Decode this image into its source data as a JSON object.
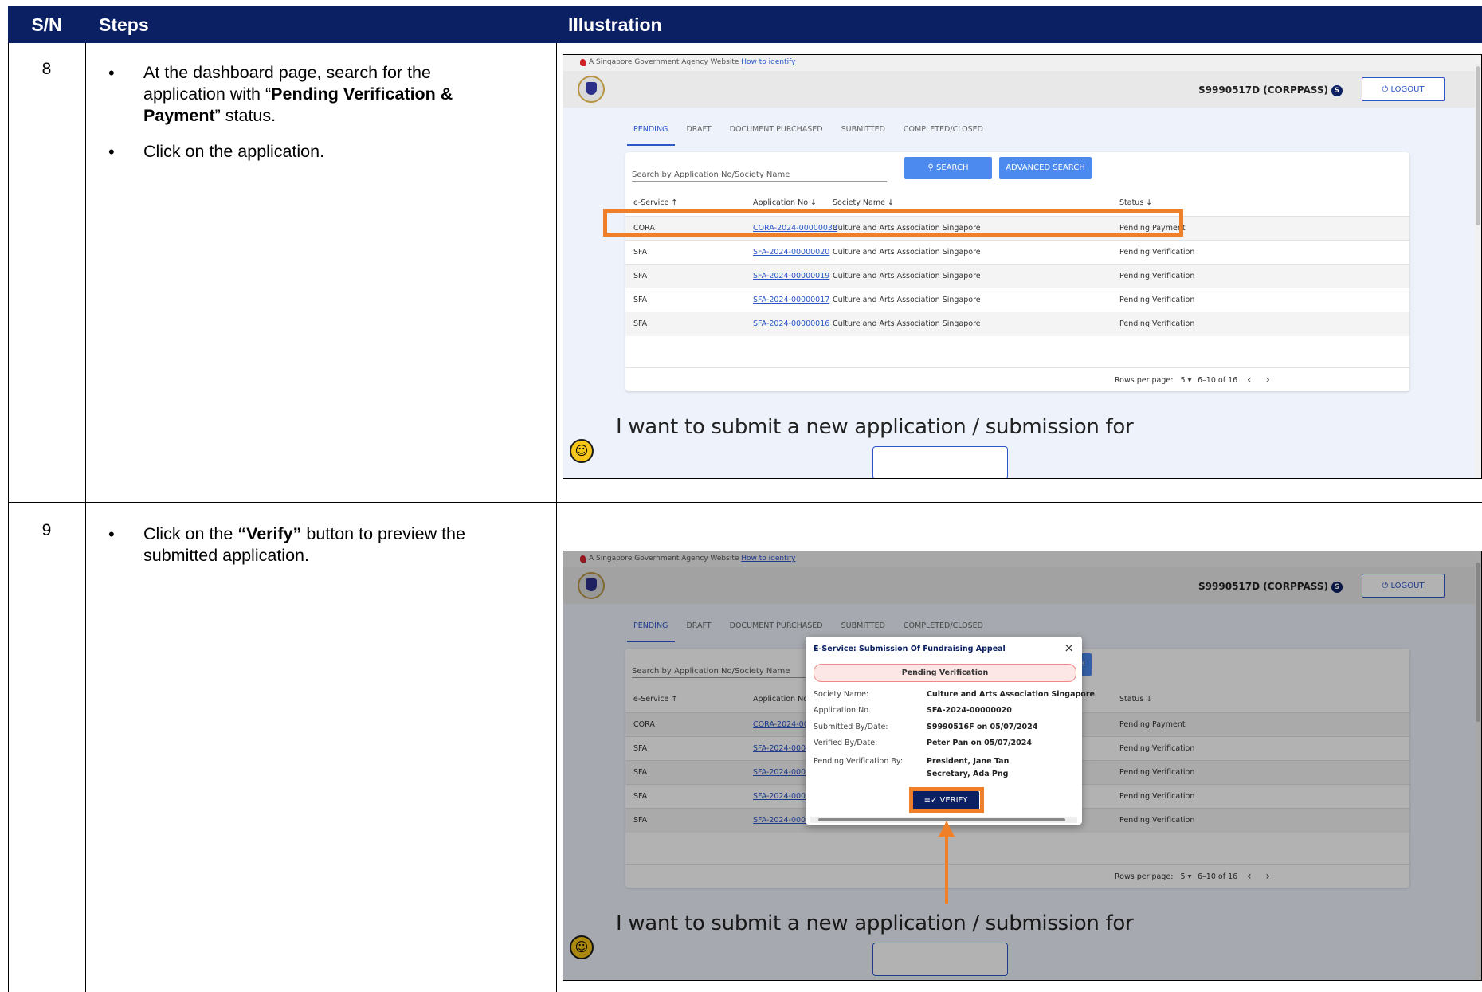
{
  "table": {
    "headers": {
      "sn": "S/N",
      "steps": "Steps",
      "illustration": "Illustration"
    },
    "header_color": "#0b2063",
    "rows": [
      {
        "sn": "8",
        "step1_pre": "At the dashboard page, search for the application with “",
        "step1_bold": "Pending Verification & Payment",
        "step1_post": "” status.",
        "step2": "Click on the application."
      },
      {
        "sn": "9",
        "step1_pre": "Click on the ",
        "step1_bold": "“Verify”",
        "step1_post": " button to preview the submitted application."
      }
    ]
  },
  "app": {
    "gov_banner": "A Singapore Government Agency Website",
    "gov_link": "How to identify",
    "user_id": "S9990517D (CORPPASS)",
    "user_badge": "S",
    "logout": "LOGOUT",
    "tabs": [
      "PENDING",
      "DRAFT",
      "DOCUMENT PURCHASED",
      "SUBMITTED",
      "COMPLETED/CLOSED"
    ],
    "search_placeholder": "Search by Application No/Society Name",
    "search_button": "SEARCH",
    "advanced_search_button": "ADVANCED SEARCH",
    "columns": [
      "e-Service ↑",
      "Application No ↓",
      "Society Name ↓",
      "Status ↓"
    ],
    "rows": [
      {
        "service": "CORA",
        "app_no": "CORA-2024-00000033",
        "society": "Culture and Arts Association Singapore",
        "status": "Pending Payment"
      },
      {
        "service": "SFA",
        "app_no": "SFA-2024-00000020",
        "society": "Culture and Arts Association Singapore",
        "status": "Pending Verification"
      },
      {
        "service": "SFA",
        "app_no": "SFA-2024-00000019",
        "society": "Culture and Arts Association Singapore",
        "status": "Pending Verification"
      },
      {
        "service": "SFA",
        "app_no": "SFA-2024-00000017",
        "society": "Culture and Arts Association Singapore",
        "status": "Pending Verification"
      },
      {
        "service": "SFA",
        "app_no": "SFA-2024-00000016",
        "society": "Culture and Arts Association Singapore",
        "status": "Pending Verification"
      }
    ],
    "rows_per_page_label": "Rows per page:",
    "rows_per_page_value": "5",
    "range": "6–10 of 16",
    "new_application_heading": "I want to submit a new application / submission for"
  },
  "modal": {
    "title": "E-Service: Submission Of Fundraising Appeal",
    "status": "Pending Verification",
    "fields": [
      {
        "label": "Society Name:",
        "value": "Culture and Arts Association Singapore"
      },
      {
        "label": "Application No.:",
        "value": "SFA-2024-00000020"
      },
      {
        "label": "Submitted By/Date:",
        "value": "S9990516F on 05/07/2024"
      },
      {
        "label": "Verified By/Date:",
        "value": "Peter Pan on 05/07/2024"
      },
      {
        "label": "Pending Verification By:",
        "value": "President, Jane Tan",
        "value2": "Secretary, Ada Png"
      }
    ],
    "verify_button": "VERIFY"
  },
  "highlight_color": "#f07f2a"
}
